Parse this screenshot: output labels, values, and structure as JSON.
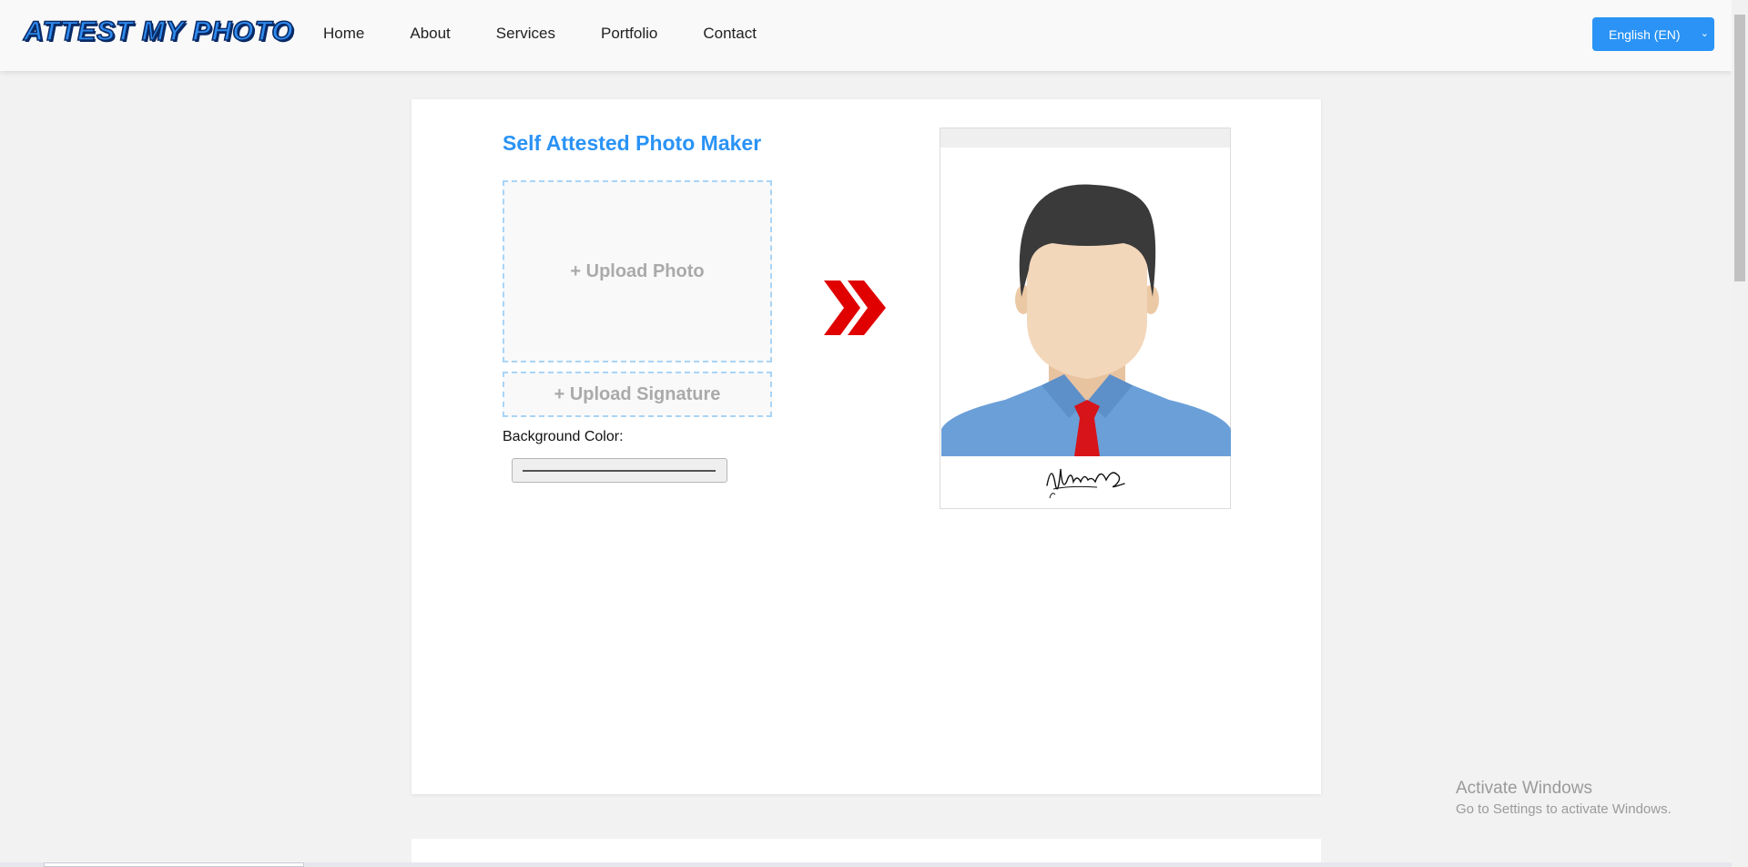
{
  "brand": {
    "logo_text": "ATTEST MY PHOTO",
    "accent_color": "#2a93f5"
  },
  "nav": {
    "items": [
      "Home",
      "About",
      "Services",
      "Portfolio",
      "Contact"
    ]
  },
  "language": {
    "selected": "English (EN)"
  },
  "main": {
    "title": "Self Attested Photo Maker",
    "upload_photo_label": "+ Upload Photo",
    "upload_signature_label": "+ Upload Signature",
    "background_color_label": "Background Color:"
  },
  "icons": {
    "arrow": "double-chevron-right-icon",
    "avatar": "avatar-placeholder-icon",
    "signature": "signature-sample",
    "language_dropdown": "chevron-down-icon"
  },
  "colors": {
    "arrow": "#e00000",
    "shirt": "#6b9fd8",
    "tie": "#d7141a",
    "hair": "#3a3a3a",
    "skin": "#f3d7bb"
  },
  "system_watermark": {
    "title": "Activate Windows",
    "subtitle": "Go to Settings to activate Windows."
  }
}
